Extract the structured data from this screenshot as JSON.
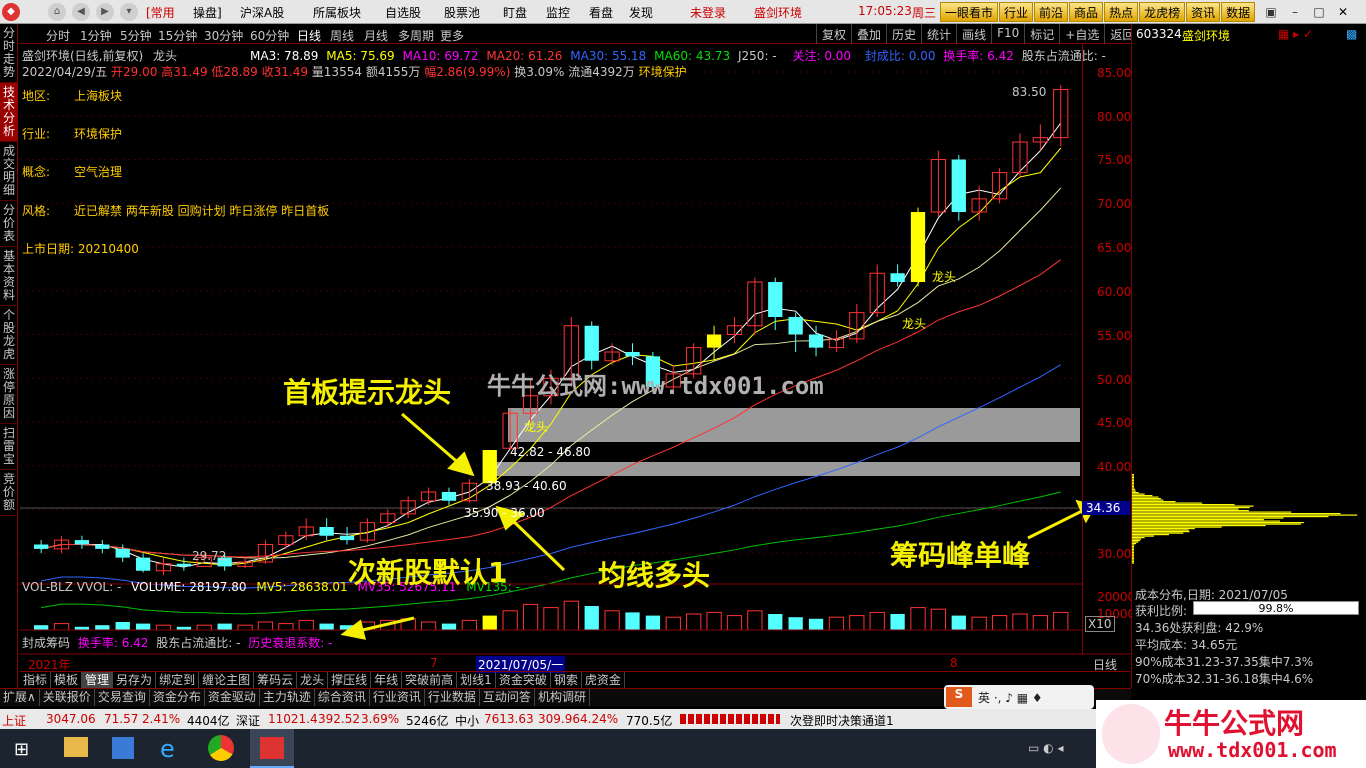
{
  "menu": {
    "nav_back": "◀",
    "nav_fwd": "▶",
    "nav_home": "⌂",
    "items": [
      "[常用",
      "操盘]",
      "沪深A股",
      "所属板块",
      "自选股",
      "股票池",
      "盯盘",
      "监控",
      "看盘",
      "发现"
    ],
    "login": "未登录",
    "stock_title": "盛剑环境",
    "time": "17:05:23",
    "weekday": "周三",
    "top_tabs": [
      "一眼看市",
      "行业",
      "前沿",
      "商品",
      "热点",
      "龙虎榜",
      "资讯",
      "数据"
    ]
  },
  "sidebar": [
    "分时走势",
    "技术分析",
    "成交明细",
    "分价表",
    "基本资料",
    "个股龙虎",
    "涨停原因",
    "扫雷宝",
    "竞价额"
  ],
  "periods": [
    "分时",
    "1分钟",
    "5分钟",
    "15分钟",
    "30分钟",
    "60分钟",
    "日线",
    "周线",
    "月线",
    "多周期",
    "更多"
  ],
  "toolbar": [
    "复权",
    "叠加",
    "历史",
    "统计",
    "画线",
    "F10",
    "标记",
    "+自选",
    "返回"
  ],
  "chart_head": {
    "name": "盛剑环境(日线,前复权)",
    "indicator": "龙头",
    "ma3": "MA3: 78.89",
    "ma5": "MA5: 75.69",
    "ma10": "MA10: 69.72",
    "ma20": "MA20: 61.26",
    "ma30": "MA30: 55.18",
    "ma60": "MA60: 43.73",
    "j250": "J250: -",
    "follow": "关注: 0.00",
    "seal": "封成比: 0.00",
    "turnover": "换手率: 6.42",
    "float_ratio": "股东占流通比: -"
  },
  "bar_info": {
    "date": "2022/04/29/五",
    "open": "开29.00",
    "high": "高31.49",
    "low": "低28.89",
    "close": "收31.49",
    "vol": "量13554",
    "amt": "额4155万",
    "pct": "幅2.86(9.99%)",
    "turn": "换3.09%",
    "float": "流通4392万",
    "sector": "环境保护"
  },
  "stock_info": [
    {
      "k": "地区:",
      "v": "上海板块"
    },
    {
      "k": "行业:",
      "v": "环境保护"
    },
    {
      "k": "概念:",
      "v": "空气治理"
    },
    {
      "k": "风格:",
      "v": "近已解禁 两年新股 回购计划 昨日涨停 昨日首板"
    }
  ],
  "listing": "上市日期: 20210400",
  "price_axis": [
    "85.00",
    "80.00",
    "75.00",
    "70.00",
    "65.00",
    "60.00",
    "55.00",
    "50.00",
    "45.00",
    "40.00",
    "35.00",
    "30.00"
  ],
  "cursor_price": "34.36",
  "chart_labels": {
    "high": "83.50",
    "low": "29.72",
    "zone1": "42.82 - 46.80",
    "zone2": "38.93 - 40.60",
    "zone3": "35.90 - 36.00",
    "dragon": "龙头"
  },
  "annotations": {
    "a1": "首板提示龙头",
    "a2": "次新股默认1",
    "a3": "均线多头",
    "a4": "筹码峰单峰"
  },
  "watermark": "牛牛公式网:www.tdx001.com",
  "vol_head": {
    "name": "VOL-BLZ VVOL: -",
    "volume": "VOLUME: 28197.80",
    "mv5": "MV5: 28638.01",
    "mv35": "MV35: 52675.11",
    "mv135": "MV135: -"
  },
  "vol_axis": [
    "20000",
    "10000"
  ],
  "vol_unit": "X10",
  "seal_head": {
    "name": "封成筹码",
    "turnover": "换手率: 6.42",
    "float": "股东占流通比: -",
    "decay": "历史衰退系数: -"
  },
  "time_axis": {
    "year": "2021年",
    "m7": "7",
    "date": "2021/07/05/一",
    "m8": "8",
    "period": "日线"
  },
  "right_panel": {
    "code": "603324",
    "name": "盛剑环境",
    "chip_date": "成本分布,日期: 2021/07/05",
    "profit_label": "获利比例:",
    "profit_val": "99.8%",
    "at_price": "34.36处获利盘: 42.9%",
    "avg_cost": "平均成本: 34.65元",
    "c90": "90%成本31.23-37.35集中7.3%",
    "c70": "70%成本32.31-36.18集中4.6%"
  },
  "bottom_tabs1": [
    "指标",
    "模板",
    "管理",
    "另存为",
    "绑定到",
    "缠论主图",
    "筹码云",
    "龙头",
    "撑压线",
    "年线",
    "突破前高",
    "划线1",
    "资金突破",
    "钢索",
    "虎资金"
  ],
  "bottom_tabs2": [
    "扩展∧",
    "关联报价",
    "交易查询",
    "资金分布",
    "资金驱动",
    "主力轨迹",
    "综合资讯",
    "行业资讯",
    "行业数据",
    "互动问答",
    "机构调研"
  ],
  "status": {
    "sh": "上证",
    "sh_val": "3047.06",
    "sh_chg": "71.57",
    "sh_pct": "2.41%",
    "sh_amt": "4404亿",
    "sz": "深证",
    "sz_val": "11021.4",
    "sz_chg": "392.52",
    "sz_pct": "3.69%",
    "sz_amt": "5246亿",
    "zx": "中小",
    "zx_val": "7613.63",
    "zx_chg": "309.96",
    "zx_pct": "4.24%",
    "zx_amt": "770.5亿",
    "msg": "次登即时决策通道1"
  },
  "logo": {
    "brand": "牛牛公式网",
    "url": "www.tdx001.com"
  },
  "colors": {
    "up": "#ff3232",
    "down": "#54ffff",
    "bg": "#000000",
    "yellow": "#ffff00",
    "accent": "#c00000"
  }
}
